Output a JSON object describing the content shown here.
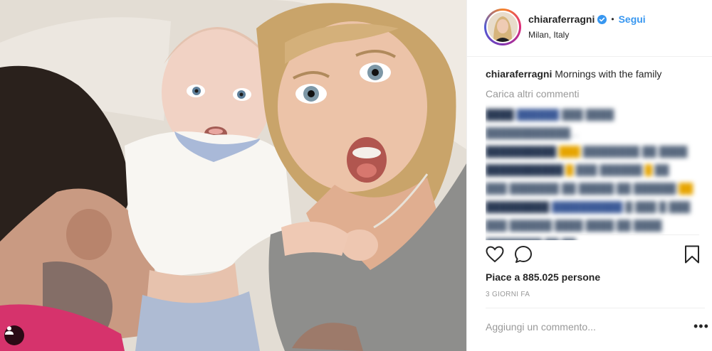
{
  "post": {
    "username": "chiaraferragni",
    "follow_label": "Segui",
    "separator": "•",
    "location": "Milan, Italy",
    "caption_user": "chiaraferragni",
    "caption_text": "Mornings with the family",
    "load_more_label": "Carica altri commenti",
    "likes_prefix": "Piace a",
    "likes_count": "885.025",
    "likes_suffix": "persone",
    "time_ago": "3 GIORNI FA",
    "comment_placeholder": "Aggiungi un commento...",
    "more_options": "•••"
  },
  "icons": {
    "verified": "verified-badge-icon",
    "like": "heart-icon",
    "comment": "comment-bubble-icon",
    "save": "bookmark-icon",
    "tag": "person-tag-icon"
  },
  "colors": {
    "link_blue": "#3897f0",
    "muted": "#999999",
    "text": "#262626"
  }
}
